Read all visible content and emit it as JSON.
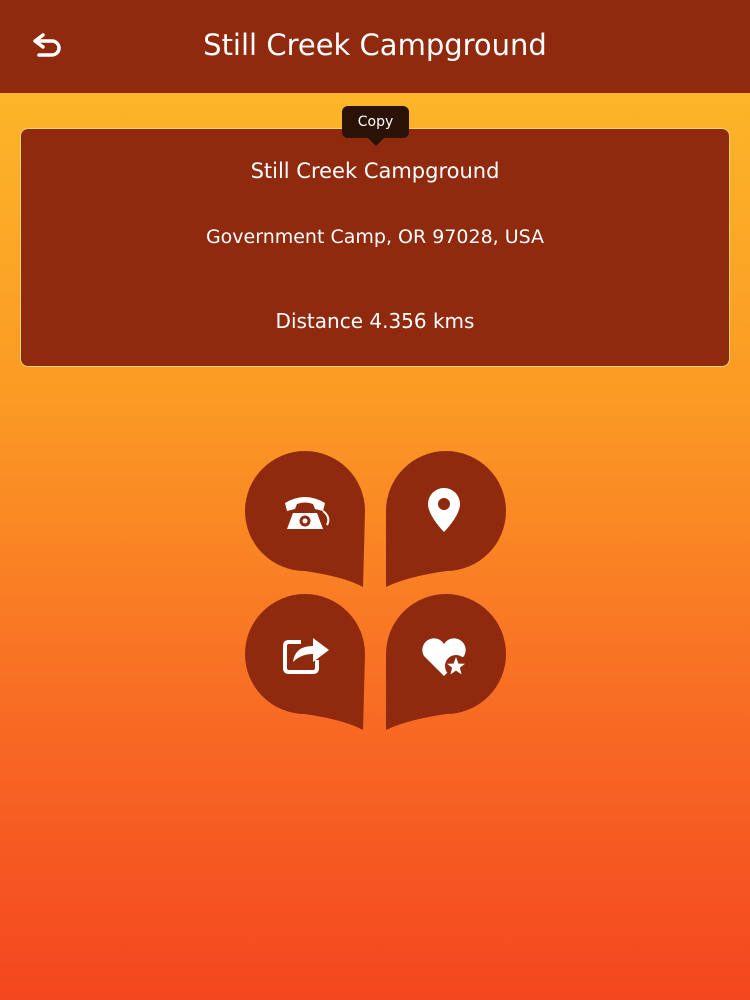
{
  "header": {
    "title": "Still Creek Campground",
    "back_icon": "back-arrow-icon"
  },
  "tooltip": {
    "label": "Copy"
  },
  "card": {
    "name": "Still Creek Campground",
    "address": "Government Camp, OR 97028, USA",
    "distance": "Distance 4.356 kms"
  },
  "actions": [
    {
      "id": "call",
      "icon": "phone-icon"
    },
    {
      "id": "location",
      "icon": "map-pin-icon"
    },
    {
      "id": "share",
      "icon": "share-icon"
    },
    {
      "id": "favorite",
      "icon": "heart-star-icon"
    }
  ],
  "colors": {
    "primary": "#8f2a0e",
    "gradient_top": "#fcbd2a",
    "gradient_bottom": "#f4461f",
    "text": "#ffffff"
  }
}
